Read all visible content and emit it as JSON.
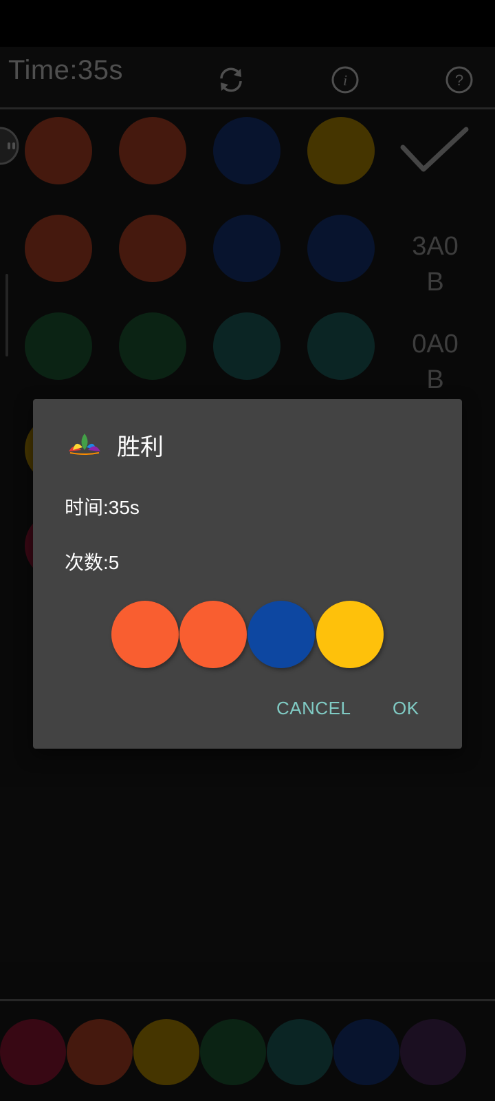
{
  "header": {
    "time": "Time:35s"
  },
  "icons": {
    "refresh": "refresh-icon",
    "info": "info-icon",
    "help": "help-icon",
    "check": "check-icon",
    "app": "lotus-icon"
  },
  "rows": [
    {
      "colors": [
        "#6a2716",
        "#6a2716",
        "#0d1f48",
        "#6b5200"
      ],
      "result": ""
    },
    {
      "colors": [
        "#6a2716",
        "#6a2716",
        "#0d1f48",
        "#0d1f48"
      ],
      "result_line1": "3A0",
      "result_line2": "B"
    },
    {
      "colors": [
        "#11361f",
        "#11361f",
        "#123a38",
        "#123a38"
      ],
      "result_line1": "0A0",
      "result_line2": "B"
    }
  ],
  "palette": [
    "#570d1f",
    "#6a2716",
    "#6b5200",
    "#11361f",
    "#123a38",
    "#0d1f48",
    "#2a1834"
  ],
  "dialog": {
    "title": "胜利",
    "time_line": "时间:35s",
    "count_line": "次数:5",
    "answer_colors": [
      "#f95e30",
      "#f95e30",
      "#0d47a1",
      "#fec10b"
    ],
    "cancel_label": "CANCEL",
    "ok_label": "OK"
  }
}
